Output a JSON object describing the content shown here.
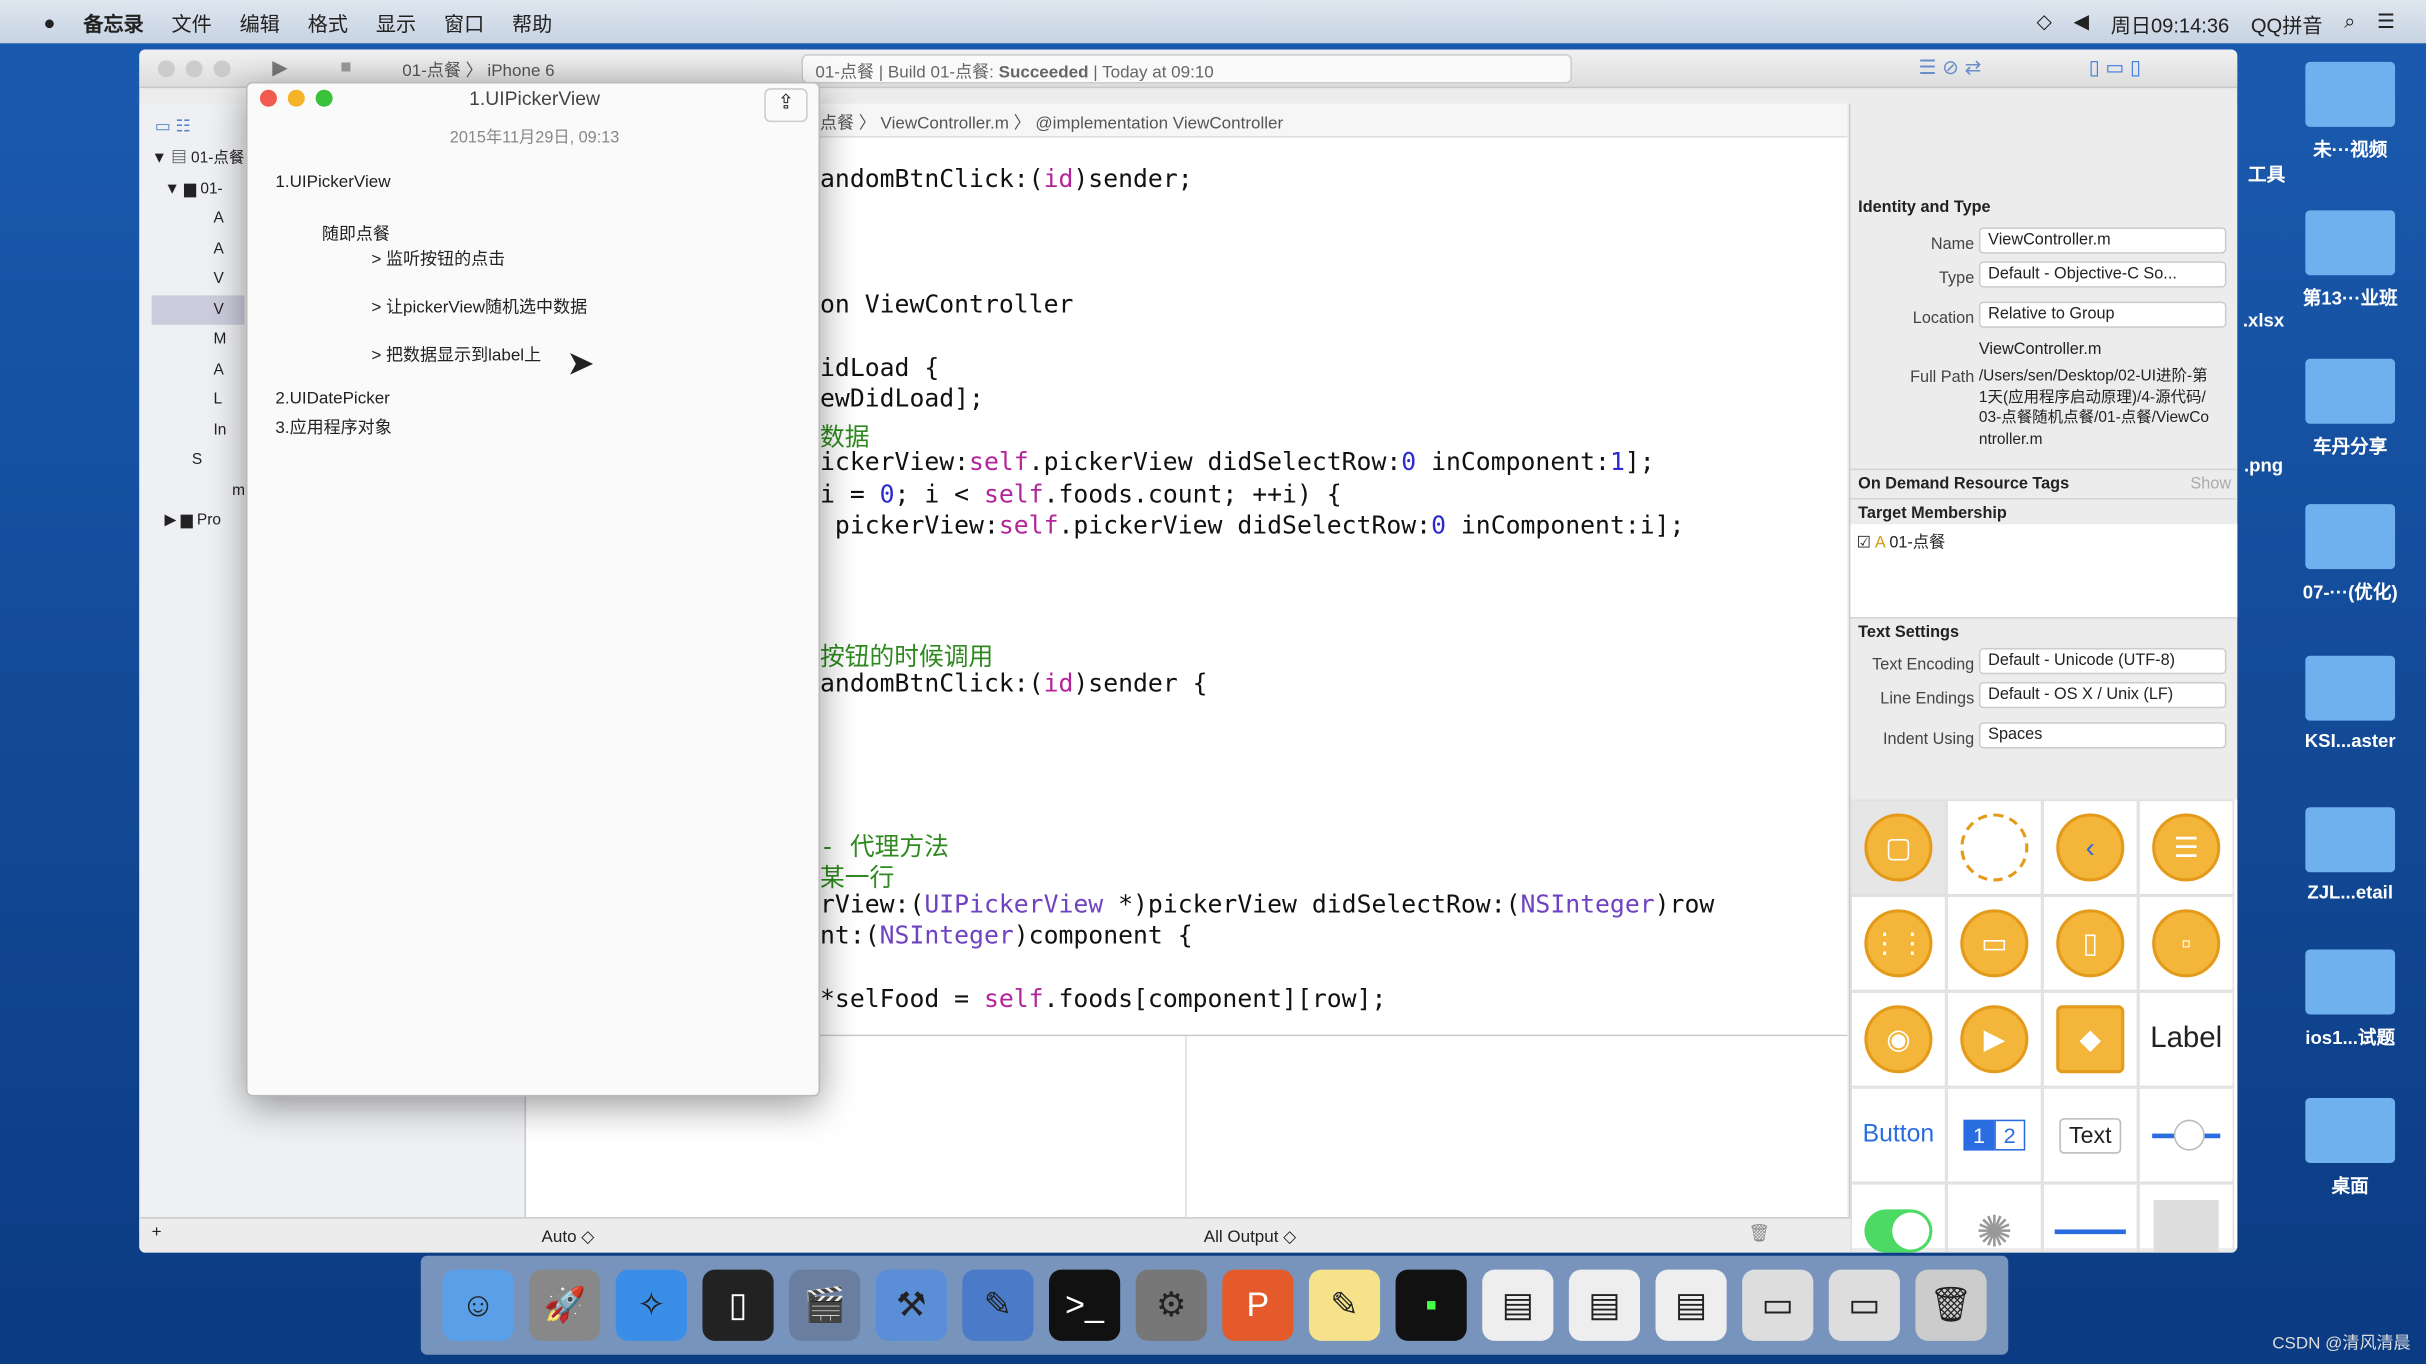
{
  "menubar": {
    "apple": "",
    "items": [
      "备忘录",
      "文件",
      "编辑",
      "格式",
      "显示",
      "窗口",
      "帮助"
    ],
    "clock": "周日09:14:36",
    "input_method": "QQ拼音"
  },
  "xcode": {
    "scheme": "01-点餐",
    "device": "iPhone 6",
    "status": {
      "project": "01-点餐",
      "build": "Build 01-点餐:",
      "result": "Succeeded",
      "time": "Today at 09:10"
    },
    "jumpbar": [
      "点餐",
      "ViewController.m",
      "@implementation ViewController"
    ],
    "navigator": {
      "items": [
        "01-点餐",
        "01-",
        "A",
        "A",
        "V",
        "V",
        "M",
        "A",
        "L",
        "In",
        "S",
        "m",
        "Pro"
      ]
    },
    "code": [
      {
        "t": "andomBtnClick:(id)sender;"
      },
      {
        "t": "on ViewController"
      },
      {
        "t": "idLoad {"
      },
      {
        "t": "ewDidLoad];"
      },
      {
        "t": "数据",
        "c": "cm"
      },
      {
        "t": "ickerView:self.pickerView didSelectRow:0 inComponent:1];"
      },
      {
        "t": "i = 0; i < self.foods.count; ++i) {"
      },
      {
        "t": " pickerView:self.pickerView didSelectRow:0 inComponent:i];"
      },
      {
        "t": "按钮的时候调用",
        "c": "cm"
      },
      {
        "t": "andomBtnClick:(id)sender {"
      },
      {
        "t": "- 代理方法",
        "c": "cm"
      },
      {
        "t": "某一行",
        "c": "cm"
      },
      {
        "t": "rView:(UIPickerView *)pickerView didSelectRow:(NSInteger)row"
      },
      {
        "t": "nt:(NSInteger)component {"
      },
      {
        "t": "*selFood = self.foods[component][row];"
      }
    ],
    "bottombar": {
      "auto": "Auto ◇",
      "output": "All Output ◇"
    },
    "inspector": {
      "identity_title": "Identity and Type",
      "name_label": "Name",
      "name": "ViewController.m",
      "type_label": "Type",
      "type": "Default - Objective-C So...",
      "location_label": "Location",
      "location": "Relative to Group",
      "location_file": "ViewController.m",
      "fullpath_label": "Full Path",
      "fullpath": "/Users/sen/Desktop/02-UI进阶-第1天(应用程序启动原理)/4-源代码/03-点餐随机点餐/01-点餐/ViewController.m",
      "ondemand_title": "On Demand Resource Tags",
      "show": "Show",
      "target_title": "Target Membership",
      "target": "01-点餐",
      "target_checked": true,
      "text_title": "Text Settings",
      "encoding_label": "Text Encoding",
      "encoding": "Default - Unicode (UTF-8)",
      "endings_label": "Line Endings",
      "endings": "Default - OS X / Unix (LF)",
      "indent_label": "Indent Using",
      "indent": "Spaces",
      "library": {
        "label": "Label",
        "button": "Button",
        "seg1": "1",
        "seg2": "2",
        "text": "Text"
      }
    }
  },
  "notes": {
    "title": "1.UIPickerView",
    "date": "2015年11月29日, 09:13",
    "lines": [
      "1.UIPickerView",
      "随即点餐",
      "> 监听按钮的点击",
      "> 让pickerView随机选中数据",
      "> 把数据显示到label上",
      "2.UIDatePicker",
      "3.应用程序对象"
    ]
  },
  "desktop": [
    "工具",
    "未···视频",
    ".xlsx",
    "第13···业班",
    ".png",
    "车丹分享",
    "07-···(优化)",
    "KSI...aster",
    "ZJL...etail",
    "ios1...试题",
    "桌面"
  ],
  "watermark": "CSDN @清风清晨",
  "colors": {
    "accent": "#f3b53a",
    "desktop": "#0d3f86",
    "keyword": "#b3249b",
    "comment": "#2e8a1f"
  }
}
